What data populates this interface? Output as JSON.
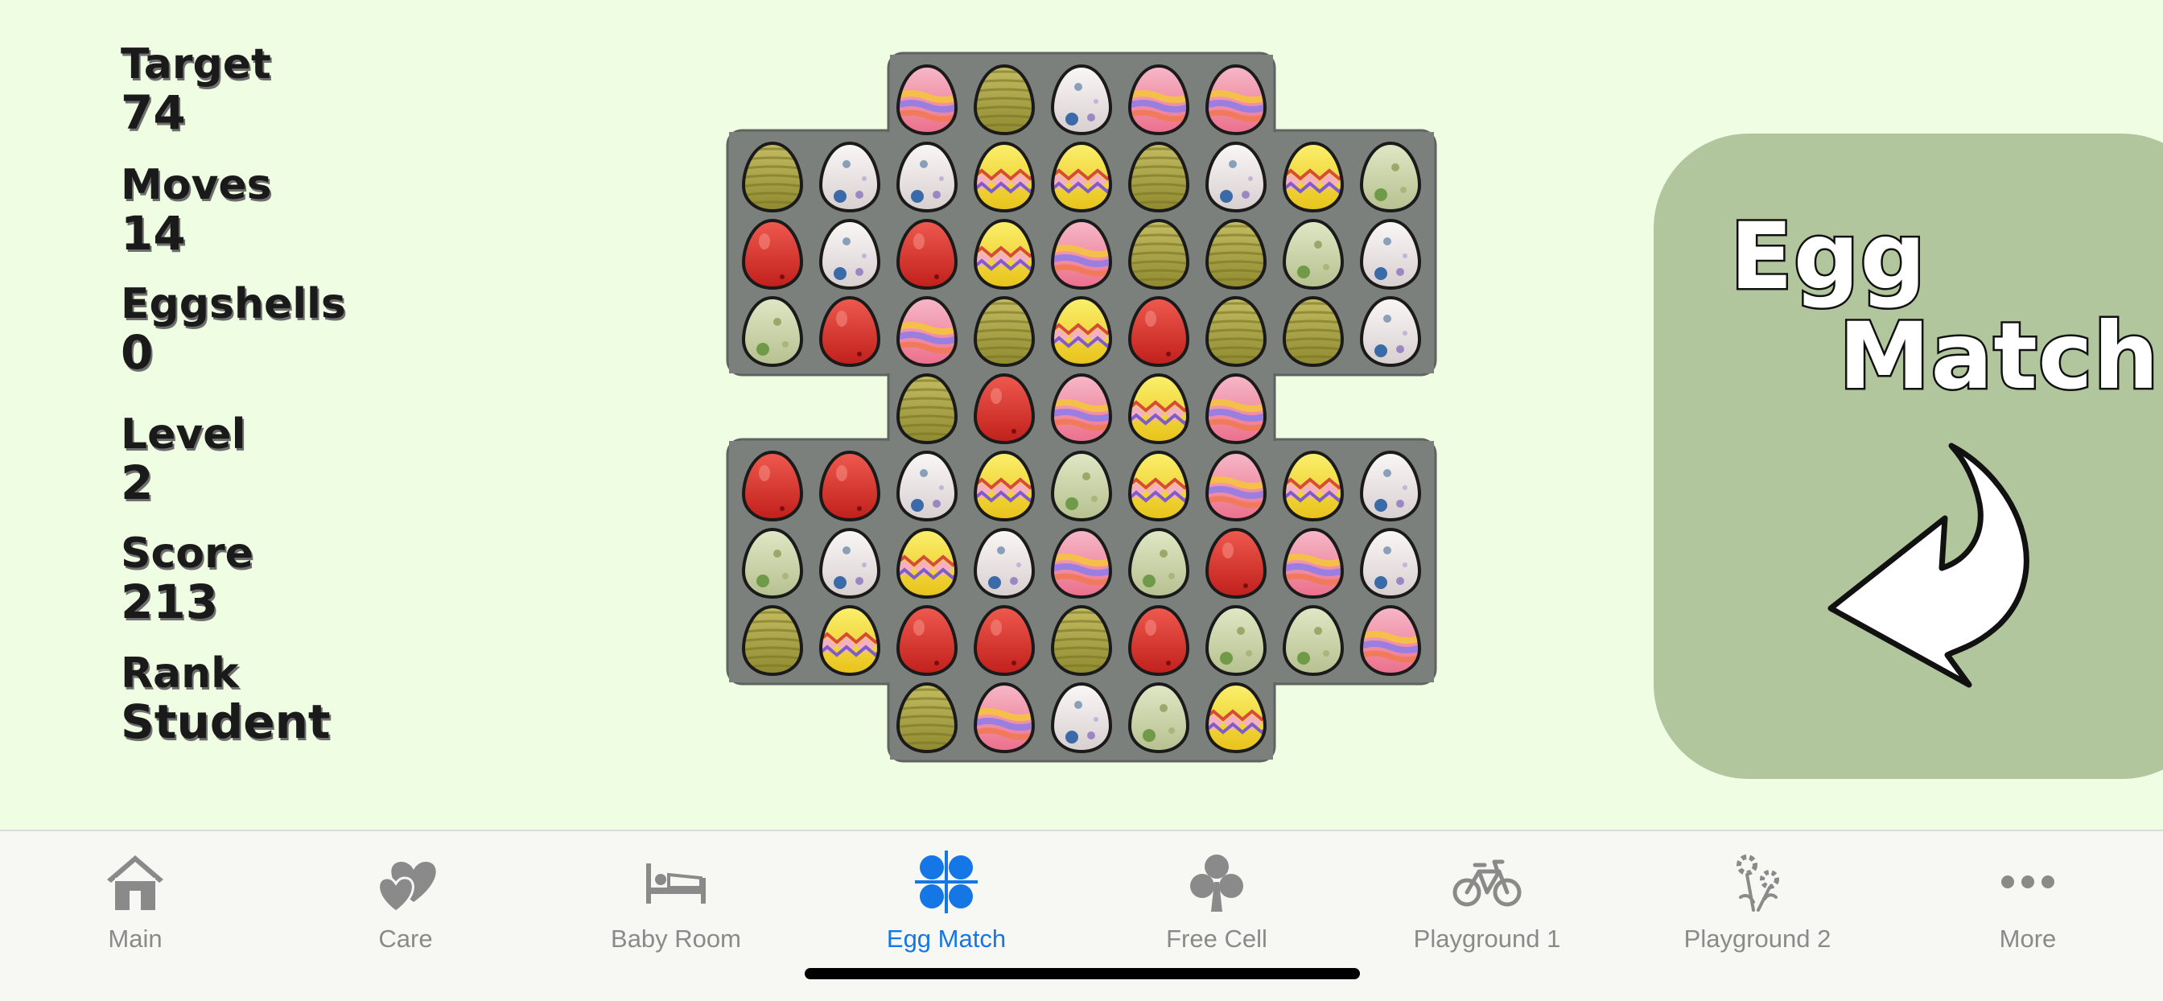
{
  "stats": {
    "target_label": "Target",
    "target_value": "74",
    "moves_label": "Moves",
    "moves_value": "14",
    "eggshells_label": "Eggshells",
    "eggshells_value": "0",
    "level_label": "Level",
    "level_value": "2",
    "score_label": "Score",
    "score_value": "213",
    "rank_label": "Rank",
    "rank_value": "Student"
  },
  "board": {
    "rows": [
      [
        "-",
        "-",
        "P",
        "O",
        "W",
        "P",
        "P",
        "-",
        "-"
      ],
      [
        "O",
        "W",
        "W",
        "Y",
        "Y",
        "O",
        "W",
        "Y",
        "G"
      ],
      [
        "R",
        "W",
        "R",
        "Y",
        "P",
        "O",
        "O",
        "G",
        "W"
      ],
      [
        "G",
        "R",
        "P",
        "O",
        "Y",
        "R",
        "O",
        "O",
        "W"
      ],
      [
        "-",
        "-",
        "O",
        "R",
        "P",
        "Y",
        "P",
        "-",
        "-"
      ],
      [
        "R",
        "R",
        "W",
        "Y",
        "G",
        "Y",
        "P",
        "Y",
        "W"
      ],
      [
        "G",
        "W",
        "Y",
        "W",
        "P",
        "G",
        "R",
        "P",
        "W"
      ],
      [
        "O",
        "Y",
        "R",
        "R",
        "O",
        "R",
        "G",
        "G",
        "P"
      ],
      [
        "-",
        "-",
        "O",
        "P",
        "W",
        "G",
        "Y",
        "-",
        "-"
      ]
    ],
    "egg_types": {
      "P": "pink-striped-egg",
      "O": "olive-striped-egg",
      "W": "white-spotted-egg",
      "Y": "yellow-zigzag-egg",
      "G": "green-spotted-egg",
      "R": "red-egg"
    },
    "colors": {
      "board": "#7b807c",
      "board_edge": "#5f6460"
    }
  },
  "logo": {
    "line1": "Egg",
    "line2": "Match",
    "panel_color": "#b1c69d"
  },
  "tabs": [
    {
      "label": "Main",
      "icon": "house-icon",
      "active": false
    },
    {
      "label": "Care",
      "icon": "hearts-icon",
      "active": false
    },
    {
      "label": "Baby Room",
      "icon": "bed-icon",
      "active": false
    },
    {
      "label": "Egg Match",
      "icon": "grid-dots-icon",
      "active": true
    },
    {
      "label": "Free Cell",
      "icon": "club-icon",
      "active": false
    },
    {
      "label": "Playground 1",
      "icon": "bicycle-icon",
      "active": false
    },
    {
      "label": "Playground 2",
      "icon": "flowers-icon",
      "active": false
    },
    {
      "label": "More",
      "icon": "ellipsis-icon",
      "active": false
    }
  ],
  "theme": {
    "accent": "#1577e6",
    "inactive": "#8a8a8a",
    "background": "#effde3"
  }
}
